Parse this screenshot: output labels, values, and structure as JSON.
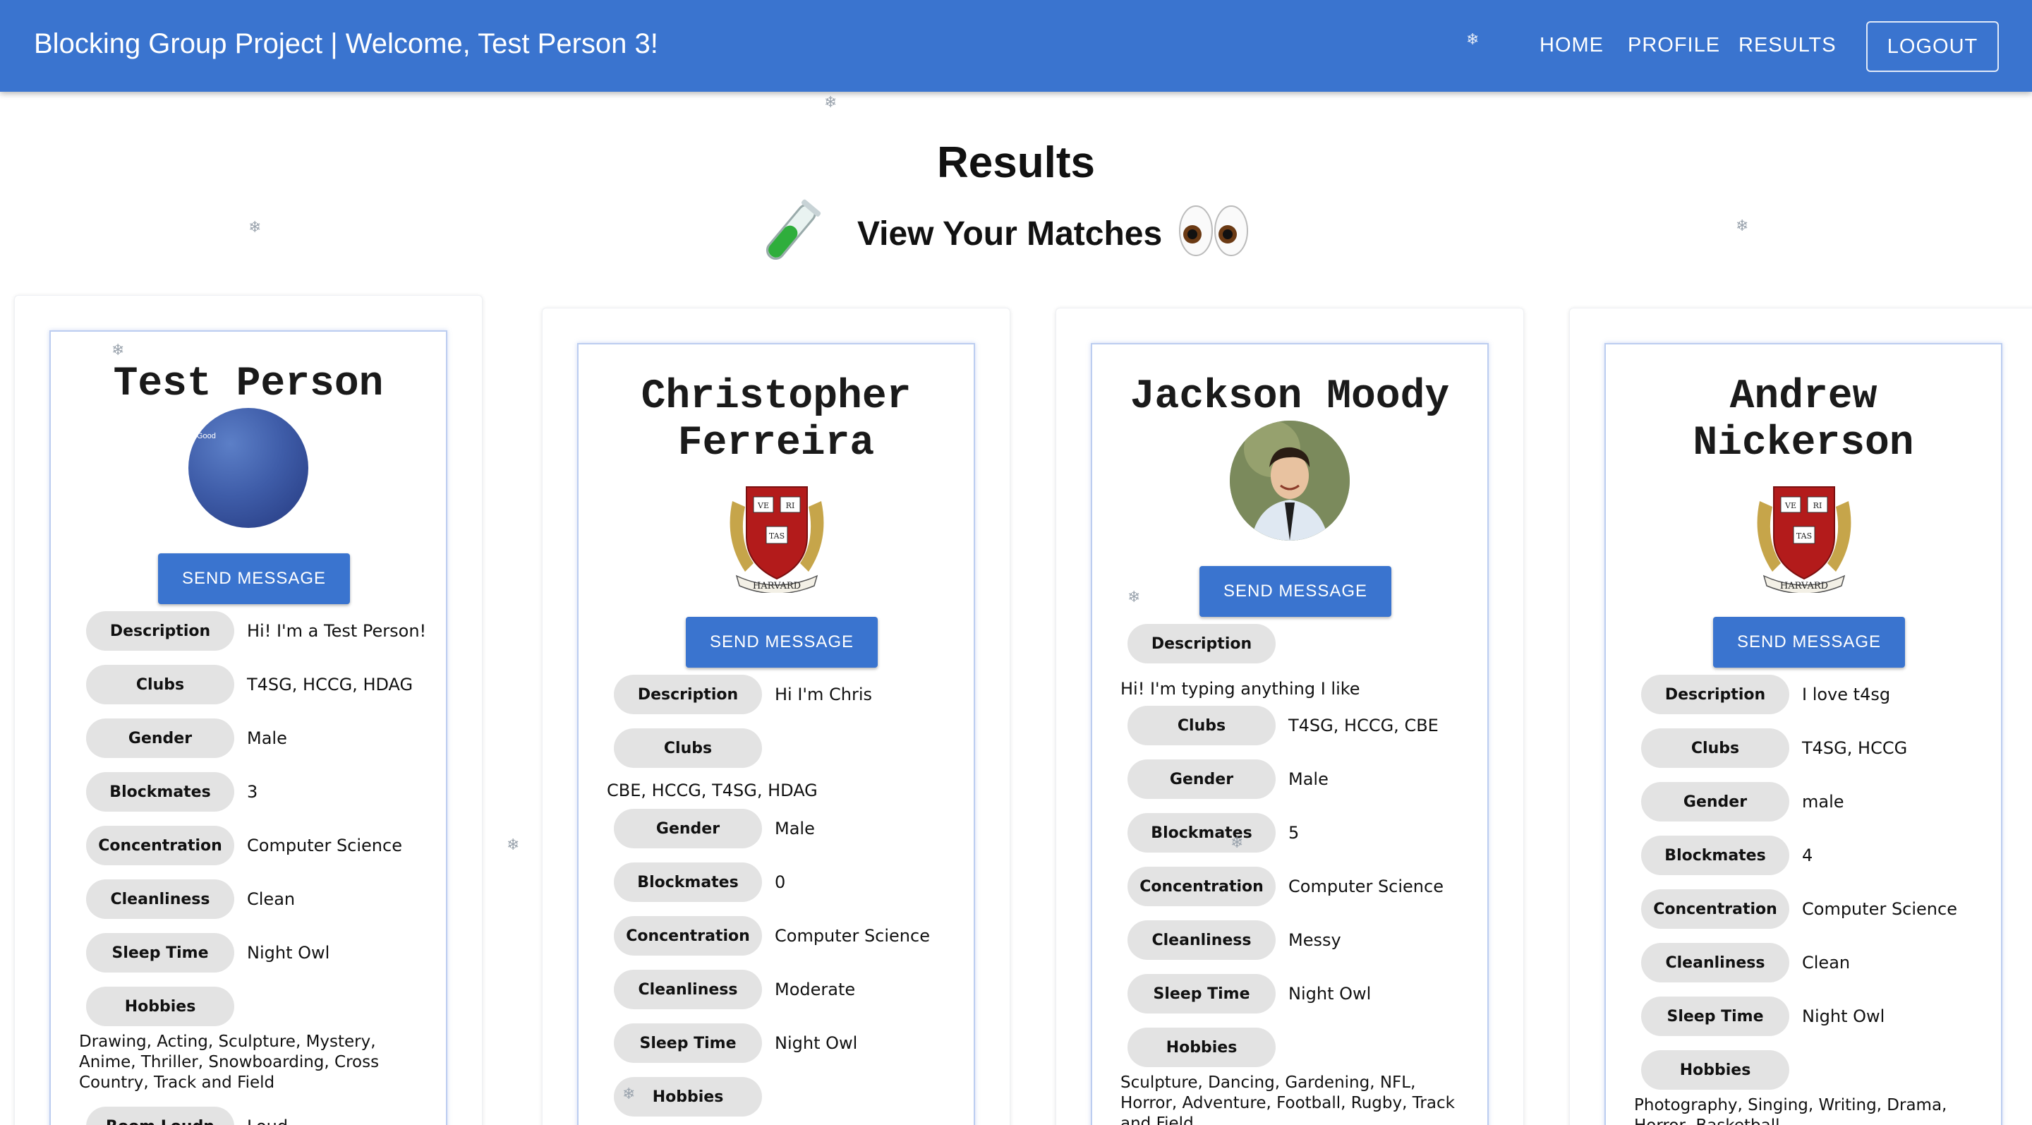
{
  "appbar": {
    "title": "Blocking Group Project | Welcome, Test Person 3!",
    "nav": [
      "HOME",
      "PROFILE",
      "RESULTS"
    ],
    "logout": "LOGOUT"
  },
  "page": {
    "title": "Results",
    "subtitle": "View Your Matches",
    "subtitle_left_emoji": "test-tube",
    "subtitle_right_emoji": "eyes"
  },
  "cards": [
    {
      "name_lines": [
        "Test Person"
      ],
      "avatar": "blue-gradient-photo",
      "avatar_text": "Good",
      "send": "SEND MESSAGE",
      "fields": [
        {
          "label": "Description",
          "value": "Hi! I'm a Test Person!"
        },
        {
          "label": "Clubs",
          "value": "T4SG, HCCG, HDAG"
        },
        {
          "label": "Gender",
          "value": "Male"
        },
        {
          "label": "Blockmates",
          "value": "3"
        },
        {
          "label": "Concentration",
          "value": "Computer Science"
        },
        {
          "label": "Cleanliness",
          "value": "Clean"
        },
        {
          "label": "Sleep Time",
          "value": "Night Owl"
        },
        {
          "label": "Hobbies",
          "value": "Drawing, Acting, Sculpture, Mystery, Anime, Thriller, Snowboarding, Cross Country, Track and Field"
        },
        {
          "label": "Room Loudn",
          "value": "Loud"
        }
      ]
    },
    {
      "name_lines": [
        "Christopher",
        "Ferreira"
      ],
      "avatar": "harvard-shield",
      "send": "SEND MESSAGE",
      "fields": [
        {
          "label": "Description",
          "value": "Hi I'm Chris"
        },
        {
          "label": "Clubs",
          "value": "CBE, HCCG, T4SG, HDAG"
        },
        {
          "label": "Gender",
          "value": "Male"
        },
        {
          "label": "Blockmates",
          "value": "0"
        },
        {
          "label": "Concentration",
          "value": "Computer Science"
        },
        {
          "label": "Cleanliness",
          "value": "Moderate"
        },
        {
          "label": "Sleep Time",
          "value": "Night Owl"
        },
        {
          "label": "Hobbies",
          "value": ""
        }
      ]
    },
    {
      "name_lines": [
        "Jackson Moody"
      ],
      "avatar": "person-photo",
      "send": "SEND MESSAGE",
      "fields": [
        {
          "label": "Description",
          "value": "Hi! I'm typing anything I like"
        },
        {
          "label": "Clubs",
          "value": "T4SG, HCCG, CBE"
        },
        {
          "label": "Gender",
          "value": "Male"
        },
        {
          "label": "Blockmates",
          "value": "5"
        },
        {
          "label": "Concentration",
          "value": "Computer Science"
        },
        {
          "label": "Cleanliness",
          "value": "Messy"
        },
        {
          "label": "Sleep Time",
          "value": "Night Owl"
        },
        {
          "label": "Hobbies",
          "value": "Sculpture, Dancing, Gardening, NFL, Horror, Adventure, Football, Rugby, Track and Field"
        }
      ]
    },
    {
      "name_lines": [
        "Andrew",
        "Nickerson"
      ],
      "avatar": "harvard-shield",
      "send": "SEND MESSAGE",
      "fields": [
        {
          "label": "Description",
          "value": "I love t4sg"
        },
        {
          "label": "Clubs",
          "value": "T4SG, HCCG"
        },
        {
          "label": "Gender",
          "value": "male"
        },
        {
          "label": "Blockmates",
          "value": "4"
        },
        {
          "label": "Concentration",
          "value": "Computer Science"
        },
        {
          "label": "Cleanliness",
          "value": "Clean"
        },
        {
          "label": "Sleep Time",
          "value": "Night Owl"
        },
        {
          "label": "Hobbies",
          "value": "Photography, Singing, Writing, Drama, Horror, Basketball"
        }
      ]
    }
  ],
  "crest": {
    "v1": "VE",
    "v2": "RI",
    "v3": "TAS",
    "banner": "HARVARD"
  },
  "colors": {
    "appbar": "#3a74cf",
    "chip": "#e3e3e3",
    "card_border": "#bccdf0"
  }
}
